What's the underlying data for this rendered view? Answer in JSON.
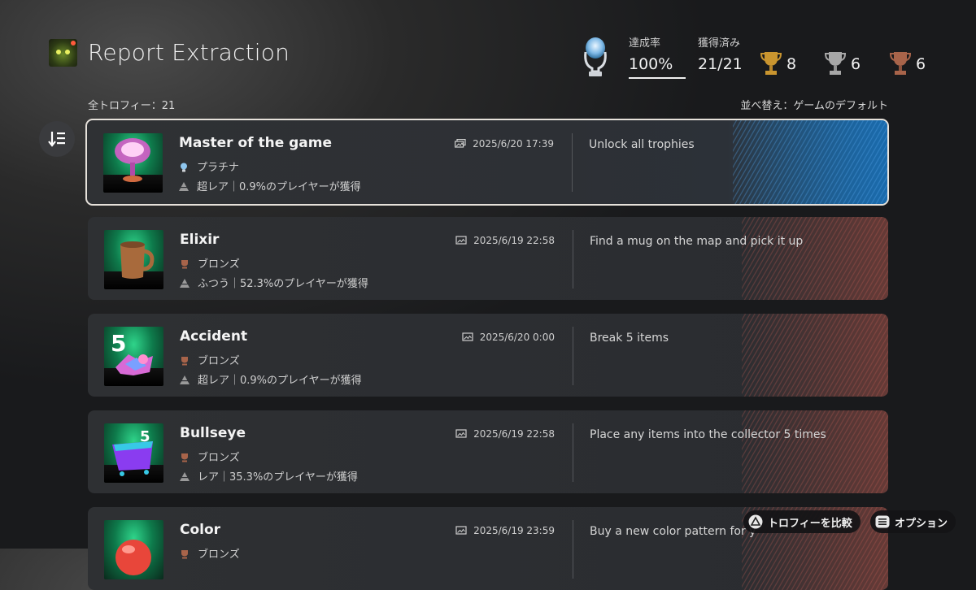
{
  "header": {
    "app_title": "Report Extraction",
    "completion_label": "達成率",
    "completion_value": "100%",
    "completion_progress": 1.0,
    "earned_label": "獲得済み",
    "earned_value": "21/21",
    "gold_count": "8",
    "silver_count": "6",
    "bronze_count": "6"
  },
  "list_header": {
    "total": "全トロフィー：21",
    "sort": "並べ替え：ゲームのデフォルト"
  },
  "trophies": [
    {
      "name": "Master of the game",
      "grade": "プラチナ",
      "rarity": "超レア｜0.9%のプレイヤーが獲得",
      "date": "2025/6/20  17:39",
      "description": "Unlock all trophies",
      "selected": true
    },
    {
      "name": "Elixir",
      "grade": "ブロンズ",
      "rarity": "ふつう｜52.3%のプレイヤーが獲得",
      "date": "2025/6/19  22:58",
      "description": "Find a mug on the map and pick it up"
    },
    {
      "name": "Accident",
      "grade": "ブロンズ",
      "rarity": "超レア｜0.9%のプレイヤーが獲得",
      "date": "2025/6/20  0:00",
      "description": "Break 5 items"
    },
    {
      "name": "Bullseye",
      "grade": "ブロンズ",
      "rarity": "レア｜35.3%のプレイヤーが獲得",
      "date": "2025/6/19  22:58",
      "description": "Place any items into the collector 5 times"
    },
    {
      "name": "Color",
      "grade": "ブロンズ",
      "rarity": "",
      "date": "2025/6/19  23:59",
      "description": "Buy a new color pattern for y"
    }
  ],
  "hints": {
    "compare_label": "トロフィーを比較",
    "options_label": "オプション"
  },
  "colors": {
    "selected_accent": "#1f5d8c",
    "card_stripe": "#c65a50",
    "gold": "#c9952f",
    "silver": "#a7a7a7",
    "bronze": "#a8644a"
  }
}
